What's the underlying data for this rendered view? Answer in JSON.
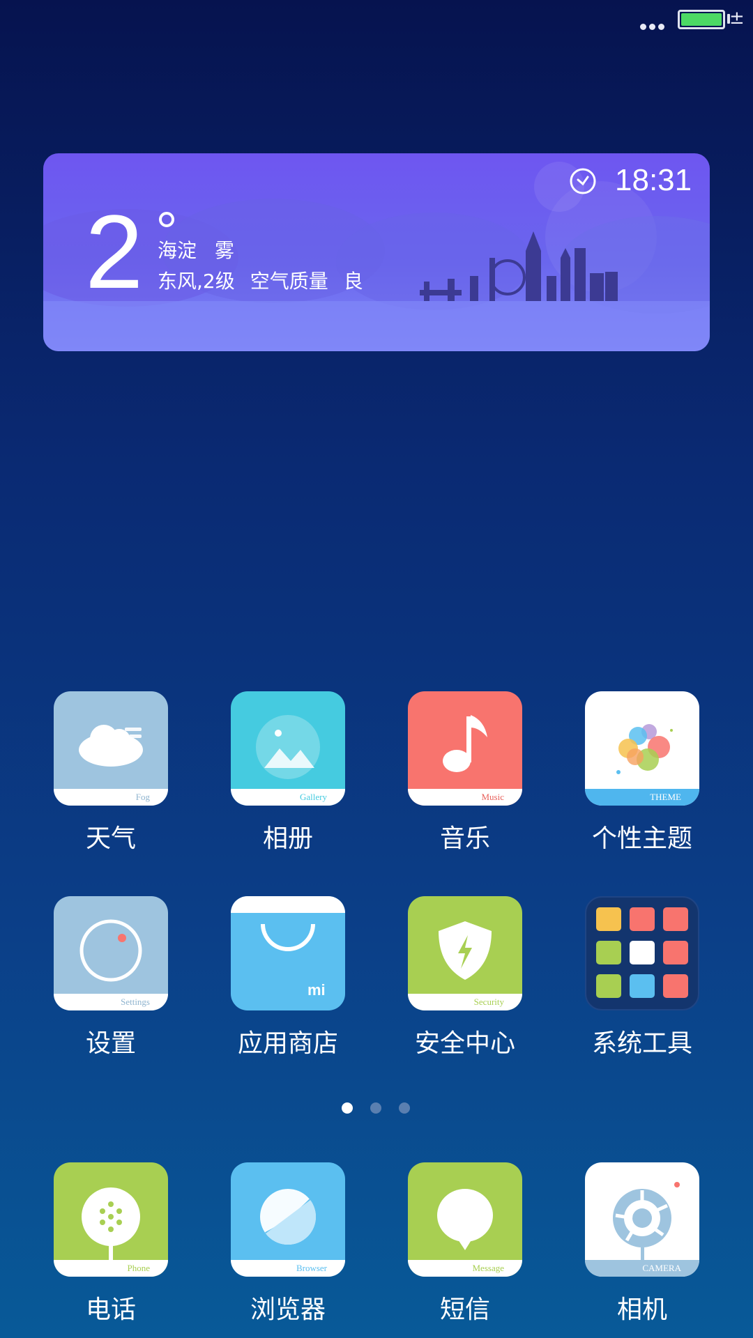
{
  "status_bar": {
    "more_icon": "more-dots-icon",
    "battery_icon": "battery-icon",
    "charging_icon": "charging-icon",
    "charging_symbol": "±",
    "battery_color": "#4cd964",
    "battery_level": 1.0
  },
  "weather_widget": {
    "temperature": "2",
    "location": "海淀",
    "condition": "雾",
    "wind": "东风,2级",
    "air_quality_label": "空气质量",
    "air_quality_value": "良",
    "time": "18:31",
    "clock_icon": "clock-icon"
  },
  "apps": [
    {
      "label": "天气",
      "caption": "Fog",
      "icon": "weather-icon"
    },
    {
      "label": "相册",
      "caption": "Gallery",
      "icon": "gallery-icon"
    },
    {
      "label": "音乐",
      "caption": "Music",
      "icon": "music-icon"
    },
    {
      "label": "个性主题",
      "caption": "THEME",
      "icon": "theme-icon"
    },
    {
      "label": "设置",
      "caption": "Settings",
      "icon": "settings-icon"
    },
    {
      "label": "应用商店",
      "caption": "",
      "icon": "app-store-icon"
    },
    {
      "label": "安全中心",
      "caption": "Security",
      "icon": "security-icon"
    },
    {
      "label": "系统工具",
      "caption": "",
      "icon": "system-tools-folder-icon"
    }
  ],
  "pager": {
    "pages": 3,
    "active": 0
  },
  "dock": [
    {
      "label": "电话",
      "caption": "Phone",
      "icon": "phone-icon"
    },
    {
      "label": "浏览器",
      "caption": "Browser",
      "icon": "browser-icon"
    },
    {
      "label": "短信",
      "caption": "Message",
      "icon": "message-icon"
    },
    {
      "label": "相机",
      "caption": "CAMERA",
      "icon": "camera-icon"
    }
  ],
  "colors": {
    "weather": "#9ec4df",
    "gallery": "#45cbe0",
    "music": "#f8746e",
    "settings": "#9ec4df",
    "store": "#5bbff0",
    "security": "#a8cf52",
    "phone": "#a8cf52",
    "browser": "#5bbff0",
    "message": "#a8cf52"
  }
}
